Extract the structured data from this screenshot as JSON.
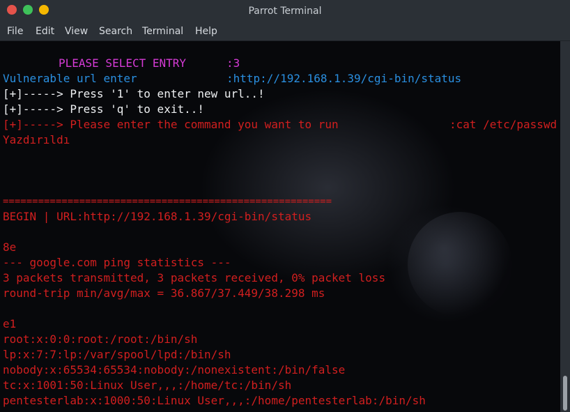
{
  "window": {
    "title": "Parrot Terminal"
  },
  "menu": [
    "File",
    "Edit",
    "View",
    "Search",
    "Terminal",
    "Help"
  ],
  "terminal": {
    "select_label": "PLEASE SELECT ENTRY",
    "select_value": ":3",
    "url_label": "Vulnerable url enter",
    "url_value": ":http://192.168.1.39/cgi-bin/status",
    "opt_new": "[+]-----> Press '1' to enter new url..!",
    "opt_exit": "[+]-----> Press 'q' to exit..!",
    "cmd_prompt": "[+]-----> Please enter the command you want to run",
    "cmd_value": ":cat /etc/passwd",
    "printed": "Yazdırıldı",
    "separator": "========================================================",
    "begin": "BEGIN | URL:http://192.168.1.39/cgi-bin/status",
    "chunk1": "8e",
    "ping_header": "--- google.com ping statistics ---",
    "ping_packets": "3 packets transmitted, 3 packets received, 0% packet loss",
    "ping_rtt": "round-trip min/avg/max = 36.867/37.449/38.298 ms",
    "chunk2": "e1",
    "passwd": [
      "root:x:0:0:root:/root:/bin/sh",
      "lp:x:7:7:lp:/var/spool/lpd:/bin/sh",
      "nobody:x:65534:65534:nobody:/nonexistent:/bin/false",
      "tc:x:1001:50:Linux User,,,:/home/tc:/bin/sh",
      "pentesterlab:x:1000:50:Linux User,,,:/home/pentesterlab:/bin/sh"
    ]
  },
  "colors": {
    "error_red": "#d21f1f",
    "url_blue": "#2a8fe0",
    "prompt_magenta": "#d63bd6"
  }
}
